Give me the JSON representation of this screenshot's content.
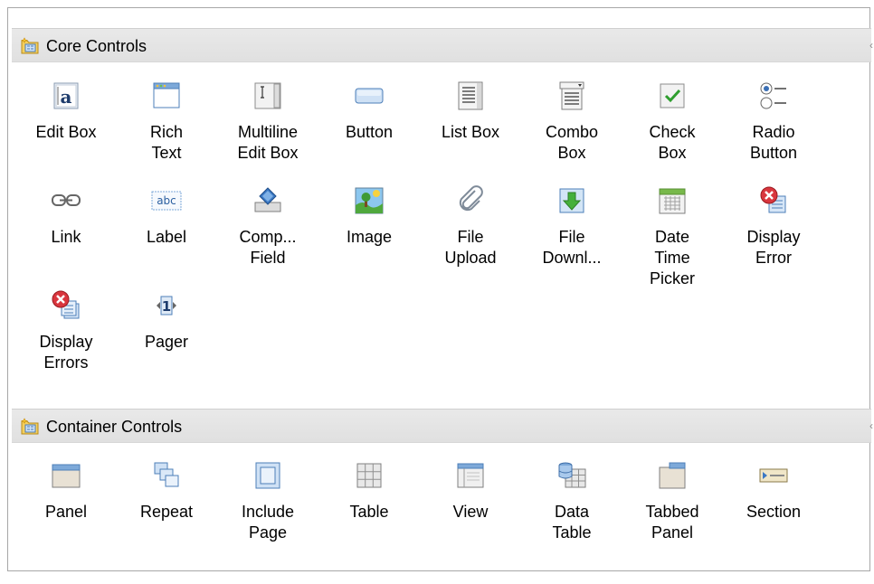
{
  "sections": [
    {
      "title": "Core Controls",
      "icon": "palette-folder-icon",
      "items": [
        {
          "line1": "Edit Box",
          "line2": "",
          "line3": "",
          "icon": "edit-box-icon"
        },
        {
          "line1": "Rich",
          "line2": "Text",
          "line3": "",
          "icon": "rich-text-icon"
        },
        {
          "line1": "Multiline",
          "line2": "Edit Box",
          "line3": "",
          "icon": "multiline-edit-box-icon"
        },
        {
          "line1": "Button",
          "line2": "",
          "line3": "",
          "icon": "button-icon"
        },
        {
          "line1": "List Box",
          "line2": "",
          "line3": "",
          "icon": "list-box-icon"
        },
        {
          "line1": "Combo",
          "line2": "Box",
          "line3": "",
          "icon": "combo-box-icon"
        },
        {
          "line1": "Check",
          "line2": "Box",
          "line3": "",
          "icon": "check-box-icon"
        },
        {
          "line1": "Radio",
          "line2": "Button",
          "line3": "",
          "icon": "radio-button-icon"
        },
        {
          "line1": "Link",
          "line2": "",
          "line3": "",
          "icon": "link-icon"
        },
        {
          "line1": "Label",
          "line2": "",
          "line3": "",
          "icon": "label-icon"
        },
        {
          "line1": "Comp...",
          "line2": "Field",
          "line3": "",
          "icon": "computed-field-icon"
        },
        {
          "line1": "Image",
          "line2": "",
          "line3": "",
          "icon": "image-icon"
        },
        {
          "line1": "File",
          "line2": "Upload",
          "line3": "",
          "icon": "file-upload-icon"
        },
        {
          "line1": "File",
          "line2": "Downl...",
          "line3": "",
          "icon": "file-download-icon"
        },
        {
          "line1": "Date",
          "line2": "Time",
          "line3": "Picker",
          "icon": "date-time-picker-icon"
        },
        {
          "line1": "Display",
          "line2": "Error",
          "line3": "",
          "icon": "display-error-icon"
        },
        {
          "line1": "Display",
          "line2": "Errors",
          "line3": "",
          "icon": "display-errors-icon"
        },
        {
          "line1": "Pager",
          "line2": "",
          "line3": "",
          "icon": "pager-icon"
        }
      ]
    },
    {
      "title": "Container Controls",
      "icon": "palette-folder-icon",
      "items": [
        {
          "line1": "Panel",
          "line2": "",
          "line3": "",
          "icon": "panel-icon"
        },
        {
          "line1": "Repeat",
          "line2": "",
          "line3": "",
          "icon": "repeat-icon"
        },
        {
          "line1": "Include",
          "line2": "Page",
          "line3": "",
          "icon": "include-page-icon"
        },
        {
          "line1": "Table",
          "line2": "",
          "line3": "",
          "icon": "table-icon"
        },
        {
          "line1": "View",
          "line2": "",
          "line3": "",
          "icon": "view-icon"
        },
        {
          "line1": "Data",
          "line2": "Table",
          "line3": "",
          "icon": "data-table-icon"
        },
        {
          "line1": "Tabbed",
          "line2": "Panel",
          "line3": "",
          "icon": "tabbed-panel-icon"
        },
        {
          "line1": "Section",
          "line2": "",
          "line3": "",
          "icon": "section-icon"
        }
      ]
    }
  ],
  "colors": {
    "header_bg": "#e6e6e6",
    "border": "#a7a7a7",
    "icon_blue": "#5b8fc7",
    "check_green": "#2e9e2e",
    "error_red": "#d9363e"
  }
}
